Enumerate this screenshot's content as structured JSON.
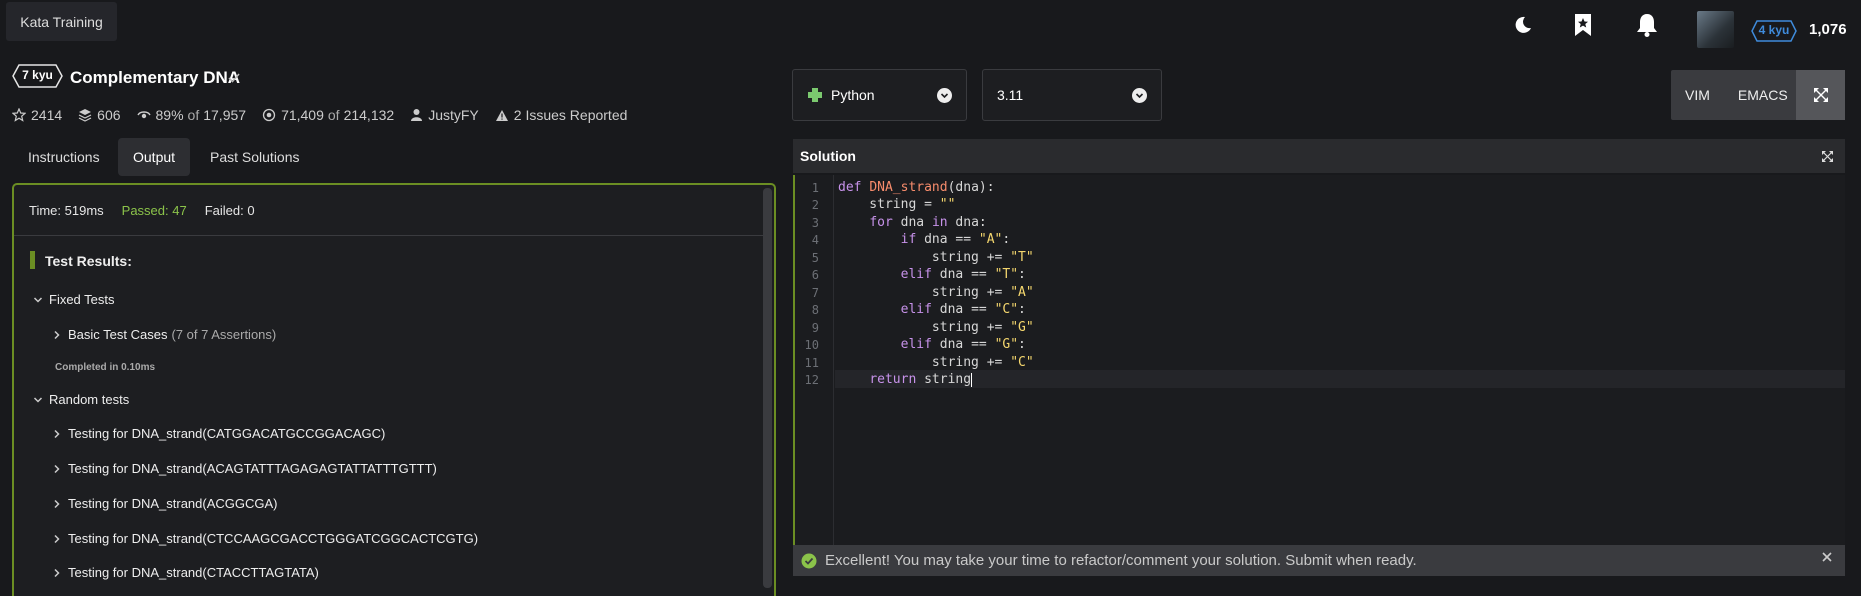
{
  "topbar": {
    "kata_training": "Kata Training",
    "user_rank": "4 kyu",
    "honor": "1,076",
    "icons": [
      "moon-icon",
      "bookmark-star-icon",
      "bell-icon"
    ]
  },
  "kata": {
    "rank": "7 kyu",
    "title": "Complementary DNA",
    "stats": {
      "stars": "2414",
      "collections": "606",
      "satisfaction": "89%",
      "of_label": "of",
      "votes": "17,957",
      "completed": "71,409",
      "attempts": "214,132",
      "author": "JustyFY",
      "issues": "2 Issues Reported"
    }
  },
  "tabs": [
    "Instructions",
    "Output",
    "Past Solutions"
  ],
  "output": {
    "time_label": "Time: 519ms",
    "passed_label": "Passed: 47",
    "failed_label": "Failed: 0",
    "results_label": "Test Results:",
    "fixed_tests": "Fixed Tests",
    "basic_cases": "Basic Test Cases",
    "basic_assertions": "(7 of 7 Assertions)",
    "completed": "Completed in 0.10ms",
    "random_tests": "Random tests",
    "random_items": [
      "Testing for DNA_strand(CATGGACATGCCGGACAGC)",
      "Testing for DNA_strand(ACAGTATTTAGAGAGTATTATTTGTTT)",
      "Testing for DNA_strand(ACGGCGA)",
      "Testing for DNA_strand(CTCCAAGCGACCTGGGATCGGCACTCGTG)",
      "Testing for DNA_strand(CTACCTTAGTATA)"
    ]
  },
  "editor": {
    "language": "Python",
    "version": "3.11",
    "modes": [
      "VIM",
      "EMACS"
    ],
    "solution_label": "Solution",
    "line_numbers": [
      "1",
      "2",
      "3",
      "4",
      "5",
      "6",
      "7",
      "8",
      "9",
      "10",
      "11",
      "12"
    ],
    "banner": "Excellent! You may take your time to refactor/comment your solution. Submit when ready."
  },
  "colors": {
    "accent_green": "#6b8e23",
    "passed_green": "#8bc34a",
    "rank_blue": "#3f8bdb"
  }
}
